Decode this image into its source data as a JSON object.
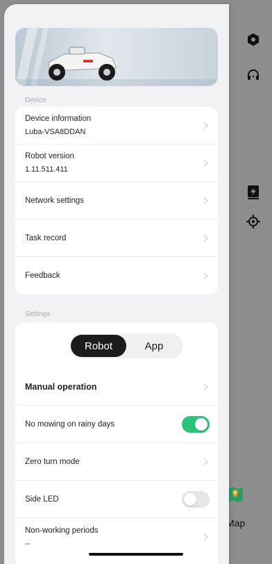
{
  "map_panel": {
    "rail_icons": [
      "hexagon-icon",
      "headset-icon",
      "charging-station-icon",
      "locate-icon"
    ],
    "map_label": "Map"
  },
  "sections": {
    "device_label": "Device",
    "settings_label": "Settings"
  },
  "device_rows": [
    {
      "title": "Device information",
      "sub": "Luba-VSA8DDAN"
    },
    {
      "title": "Robot version",
      "sub": "1.11.511.411"
    },
    {
      "title": "Network settings"
    },
    {
      "title": "Task record"
    },
    {
      "title": "Feedback"
    }
  ],
  "segmented": {
    "options": [
      "Robot",
      "App"
    ],
    "selected": "Robot"
  },
  "settings_rows": [
    {
      "title": "Manual operation",
      "control": "chevron"
    },
    {
      "title": "No mowing on rainy days",
      "control": "toggle",
      "on": true
    },
    {
      "title": "Zero turn mode",
      "control": "chevron"
    },
    {
      "title": "Side LED",
      "control": "toggle",
      "on": false
    },
    {
      "title": "Non-working periods",
      "sub": "--",
      "control": "chevron"
    }
  ],
  "colors": {
    "toggle_on": "#2bc37a",
    "segment_active": "#1c1c1e"
  }
}
